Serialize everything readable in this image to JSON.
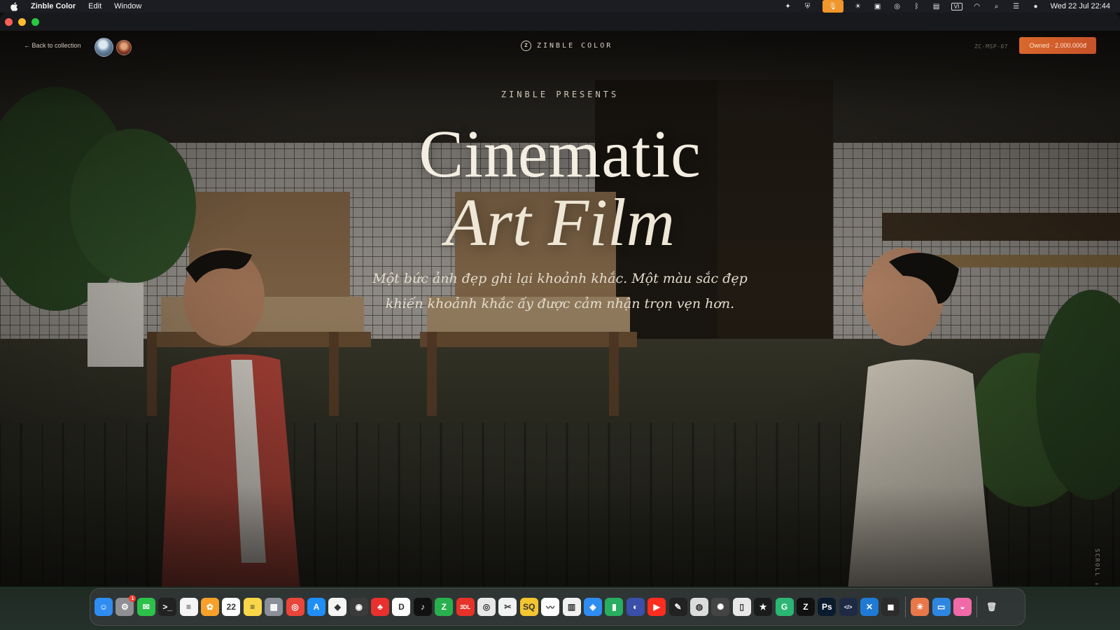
{
  "menubar": {
    "app_name": "Zinble Color",
    "menus": [
      "Edit",
      "Window"
    ],
    "tray_icons": [
      "sparkle-icon",
      "shield-icon",
      "microphone-icon",
      "brightness-icon",
      "display-icon",
      "airdrop-icon",
      "bluetooth-icon",
      "notification-icon",
      "input-source-icon",
      "wifi-icon",
      "search-icon",
      "control-center-icon",
      "siri-icon"
    ],
    "input_source": "VI",
    "clock": "Wed 22 Jul  22:44"
  },
  "page": {
    "back_label": "← Back to collection",
    "brand_mark": "Z",
    "brand_name": "ZINBLE COLOR",
    "sku": "ZC-MSP-07",
    "owned_label": "Owned · 2.000.000đ",
    "presents": "ZINBLE PRESENTS",
    "title_line1": "Cinematic",
    "title_line2": "Art Film",
    "tagline_line1": "Một bức ảnh đẹp ghi lại khoảnh khắc. Một màu sắc đẹp",
    "tagline_line2": "khiến khoảnh khắc ấy được cảm nhận trọn vẹn hơn.",
    "scroll_hint": "SCROLL ↓"
  },
  "dock": {
    "apps": [
      {
        "name": "finder-icon",
        "color": "#2f8cf0",
        "glyph": "☺"
      },
      {
        "name": "system-settings-icon",
        "color": "#8e8e93",
        "glyph": "⚙",
        "badge": "1"
      },
      {
        "name": "wechat-icon",
        "color": "#2dc04a",
        "glyph": "✉"
      },
      {
        "name": "terminal-icon",
        "color": "#222222",
        "glyph": ">_"
      },
      {
        "name": "reminders-icon",
        "color": "#f5f5f5",
        "glyph": "≡"
      },
      {
        "name": "photos-icon",
        "color": "#f7a02a",
        "glyph": "✿"
      },
      {
        "name": "calendar-icon",
        "color": "#ffffff",
        "glyph": "22"
      },
      {
        "name": "notes-icon",
        "color": "#f9d648",
        "glyph": "≡"
      },
      {
        "name": "launchpad-icon",
        "color": "#8a8f99",
        "glyph": "▦"
      },
      {
        "name": "chrome-icon",
        "color": "#e9453a",
        "glyph": "◎"
      },
      {
        "name": "app-store-icon",
        "color": "#1f8ef5",
        "glyph": "A"
      },
      {
        "name": "brave-icon",
        "color": "#f4f4f4",
        "glyph": "◆"
      },
      {
        "name": "capture-icon",
        "color": "#3b3b3b",
        "glyph": "◉"
      },
      {
        "name": "tienlen-icon",
        "color": "#e8312f",
        "glyph": "♣"
      },
      {
        "name": "dropbox-icon",
        "color": "#ffffff",
        "glyph": "D"
      },
      {
        "name": "tiktok-icon",
        "color": "#111111",
        "glyph": "♪"
      },
      {
        "name": "green-app-icon",
        "color": "#29b04e",
        "glyph": "Z"
      },
      {
        "name": "3dl-icon",
        "color": "#e5332a",
        "glyph": "3DL"
      },
      {
        "name": "obs-icon",
        "color": "#e8e8e8",
        "glyph": "◎"
      },
      {
        "name": "capcut-icon",
        "color": "#f2f2f2",
        "glyph": "✂"
      },
      {
        "name": "sq-icon",
        "color": "#f3c530",
        "glyph": "SQ"
      },
      {
        "name": "freeform-icon",
        "color": "#ffffff",
        "glyph": "〰"
      },
      {
        "name": "colorful-app-icon",
        "color": "#f1f1f1",
        "glyph": "▥"
      },
      {
        "name": "safari-icon",
        "color": "#2f8cf0",
        "glyph": "◈"
      },
      {
        "name": "numbers-icon",
        "color": "#27ae60",
        "glyph": "▮"
      },
      {
        "name": "davinci-icon",
        "color": "#3a4fa8",
        "glyph": "◐"
      },
      {
        "name": "youtube-icon",
        "color": "#ff2d20",
        "glyph": "▶"
      },
      {
        "name": "instruments-icon",
        "color": "#222222",
        "glyph": "✎"
      },
      {
        "name": "disk-utility-icon",
        "color": "#dcdcdc",
        "glyph": "◍"
      },
      {
        "name": "gear-app-icon",
        "color": "#444444",
        "glyph": "✺"
      },
      {
        "name": "script-editor-icon",
        "color": "#e8e8e8",
        "glyph": "▯"
      },
      {
        "name": "final-cut-icon",
        "color": "#1b1b1b",
        "glyph": "★"
      },
      {
        "name": "grammarly-icon",
        "color": "#2bb673",
        "glyph": "G"
      },
      {
        "name": "zinble-app-icon",
        "color": "#111111",
        "glyph": "Z"
      },
      {
        "name": "photoshop-icon",
        "color": "#0a1b2e",
        "glyph": "Ps"
      },
      {
        "name": "code-editor-icon",
        "color": "#1e2a44",
        "glyph": "</>"
      },
      {
        "name": "vscode-icon",
        "color": "#1f7ad6",
        "glyph": "✕"
      },
      {
        "name": "cube-app-icon",
        "color": "#2b2b2b",
        "glyph": "◼"
      }
    ],
    "apps_right": [
      {
        "name": "claude-icon",
        "color": "#e8774a",
        "glyph": "✳"
      },
      {
        "name": "screen-app-icon",
        "color": "#2f86e0",
        "glyph": "▭"
      },
      {
        "name": "pink-app-icon",
        "color": "#f06aa8",
        "glyph": "◒"
      }
    ],
    "trash": {
      "name": "trash-icon",
      "glyph": "🗑"
    }
  }
}
